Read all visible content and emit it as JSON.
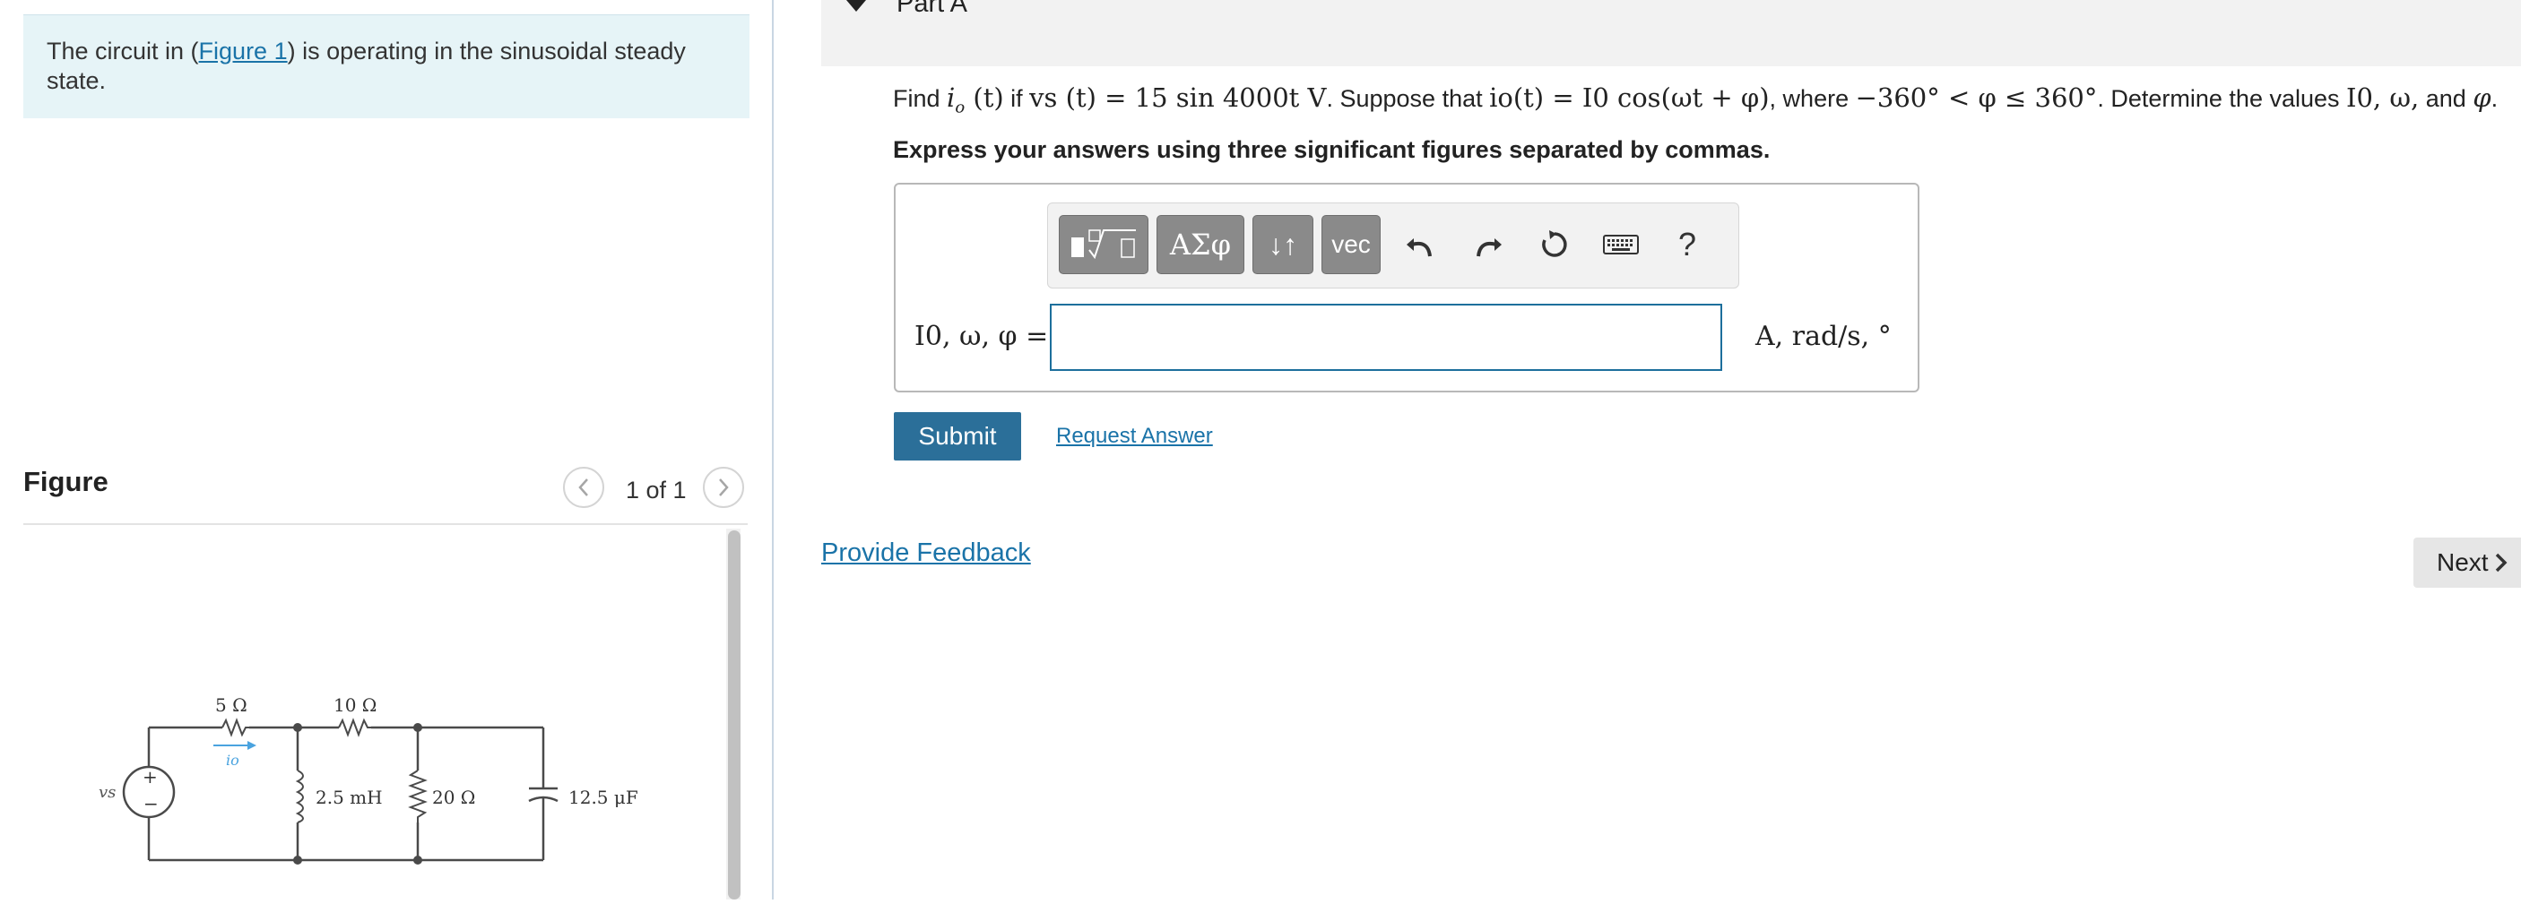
{
  "problem": {
    "intro_before_link": "The circuit in (",
    "figure_link": "Figure 1",
    "intro_after_link": ") is operating in the sinusoidal steady state."
  },
  "figure_panel": {
    "heading": "Figure",
    "counter": "1 of 1",
    "prev_icon": "chevron-left-icon",
    "next_icon": "chevron-right-icon"
  },
  "circuit": {
    "source_label": "vs",
    "r1_label": "5 Ω",
    "r2_label": "10 Ω",
    "current_label": "io",
    "inductor_label": "2.5 mH",
    "r3_label": "20 Ω",
    "capacitor_label": "12.5 μF",
    "source_plus": "+",
    "source_minus": "−"
  },
  "part": {
    "title": "Part A",
    "caret_icon": "caret-down-icon",
    "question": {
      "find": "Find ",
      "io_t": "i",
      "io_sub": "o",
      "paren_t": " (t)",
      "if_text": " if ",
      "vs_expr": "vs (t) = 15 sin 4000t V",
      "suppose": ". Suppose that ",
      "io_expr": "io(t) = I0 cos(ωt + φ)",
      "where": ", where ",
      "range_expr": "−360° < φ ≤ 360°",
      "determine": ". Determine the values ",
      "vars": "I0, ω,",
      "and": " and ",
      "phi": "φ",
      "period": "."
    },
    "instruction": "Express your answers using three significant figures separated by commas."
  },
  "toolbar": {
    "templates_icon": "templates-icon",
    "greek_label": "ΑΣφ",
    "arrows_label": "↓↑",
    "vec_label": "vec",
    "undo_icon": "undo-icon",
    "redo_icon": "redo-icon",
    "reset_icon": "reset-icon",
    "keyboard_icon": "keyboard-icon",
    "help_label": "?"
  },
  "answer": {
    "variables_label": "I0, ω, φ =",
    "value": "",
    "units": "A, rad/s, °"
  },
  "actions": {
    "submit": "Submit",
    "request_answer": "Request Answer",
    "provide_feedback": "Provide Feedback",
    "next": "Next"
  },
  "colors": {
    "intro_bg": "#e6f4f7",
    "link": "#1a73a8",
    "submit_bg": "#2b6f99",
    "input_border": "#1d6f9c",
    "toolbar_button": "#8a8a8a"
  }
}
